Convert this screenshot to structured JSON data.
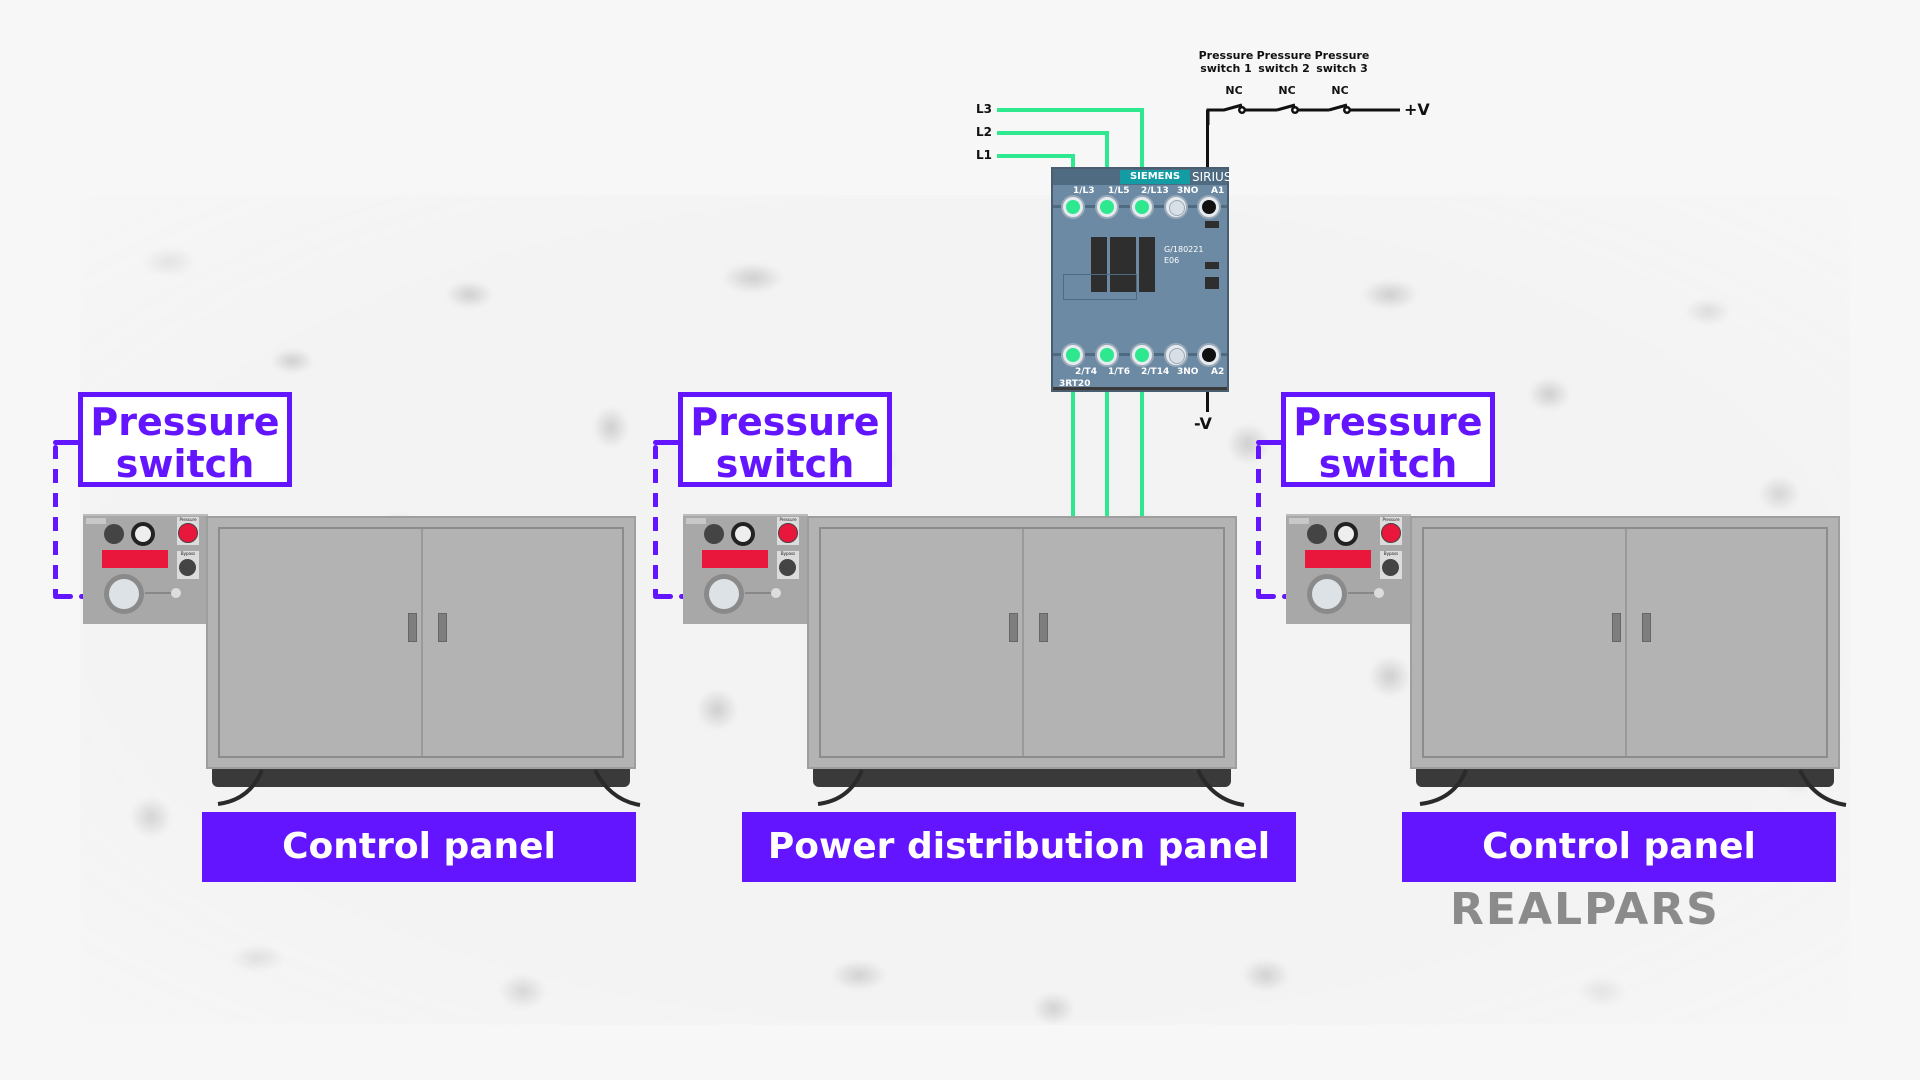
{
  "colors": {
    "accent_purple": "#6415ff",
    "phase_wire_green": "#2de88f",
    "control_wire_black": "#111111",
    "cabinet_gray": "#b3b3b3",
    "indicator_red": "#e8173b",
    "contactor_blue": "#6c8aa3"
  },
  "circuit": {
    "phases": [
      "L3",
      "L2",
      "L1"
    ],
    "pressure_switches": [
      {
        "name_line1": "Pressure",
        "name_line2": "switch 1",
        "contact": "NC"
      },
      {
        "name_line1": "Pressure",
        "name_line2": "switch 2",
        "contact": "NC"
      },
      {
        "name_line1": "Pressure",
        "name_line2": "switch 3",
        "contact": "NC"
      }
    ],
    "supply_positive": "+V",
    "supply_negative": "-V"
  },
  "contactor": {
    "brand": "SIEMENS",
    "series": "SIRIUS",
    "top_terminals": [
      "1/L3",
      "1/L5",
      "2/L13",
      "3NO",
      "A1"
    ],
    "bottom_terminals": [
      "2/T4",
      "1/T6",
      "2/T14",
      "3NO",
      "A2"
    ],
    "model": "3RT20",
    "code_line1": "G/180221",
    "code_line2": "E06"
  },
  "panels": [
    {
      "callout_line1": "Pressure",
      "callout_line2": "switch",
      "label": "Control panel",
      "module_pressure_label": "Pressure",
      "module_bypass_label": "Bypass"
    },
    {
      "callout_line1": "Pressure",
      "callout_line2": "switch",
      "label": "Power distribution panel",
      "module_pressure_label": "Pressure",
      "module_bypass_label": "Bypass"
    },
    {
      "callout_line1": "Pressure",
      "callout_line2": "switch",
      "label": "Control panel",
      "module_pressure_label": "Pressure",
      "module_bypass_label": "Bypass"
    }
  ],
  "logo": "REALPARS"
}
